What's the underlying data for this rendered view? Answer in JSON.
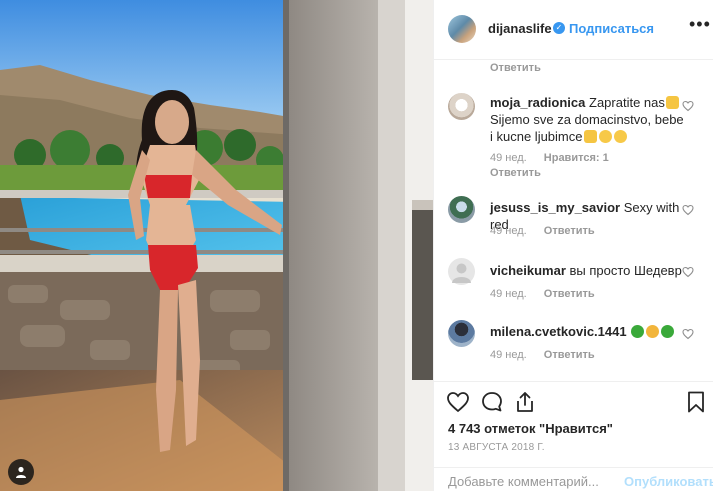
{
  "header": {
    "username": "dijanaslife",
    "separator": "•",
    "follow_label": "Подписаться",
    "more_label": "•••"
  },
  "comments_top_reply": "Ответить",
  "comments": [
    {
      "username": "moja_radionica",
      "text_line1": "Zapratite nas",
      "text_rest": "Sijemo sve za domacinstvo, bebe i kucne ljubimce",
      "emojis_after_line1": [
        "thumbs-up"
      ],
      "emojis_after_rest": [
        "thumbs-up",
        "grinning-face",
        "grinning-face"
      ],
      "age": "49 нед.",
      "likes": "Нравится: 1",
      "reply": "Ответить"
    },
    {
      "username": "jesuss_is_my_savior",
      "text": "Sexy with red",
      "age": "49 нед.",
      "reply": "Ответить"
    },
    {
      "username": "vicheikumar",
      "text": "вы просто Шедевр",
      "age": "49 нед.",
      "reply": "Ответить"
    },
    {
      "username": "milena.cvetkovic.1441",
      "text": "",
      "emojis": [
        "four-leaf-clover",
        "star-struck",
        "four-leaf-clover"
      ],
      "age": "49 нед.",
      "reply": "Ответить"
    }
  ],
  "actions": {
    "likes_text": "4 743 отметок \"Нравится\"",
    "date": "13 АВГУСТА 2018 Г."
  },
  "add_comment": {
    "placeholder": "Добавьте комментарий...",
    "publish_label": "Опубликовать"
  },
  "colors": {
    "link_blue": "#3897f0",
    "publish_disabled": "#b2dffc",
    "meta_gray": "#999999",
    "border": "#efefef"
  },
  "icons": [
    "heart-icon",
    "comment-icon",
    "share-icon",
    "bookmark-icon",
    "verified-badge-icon",
    "user-tag-icon"
  ]
}
